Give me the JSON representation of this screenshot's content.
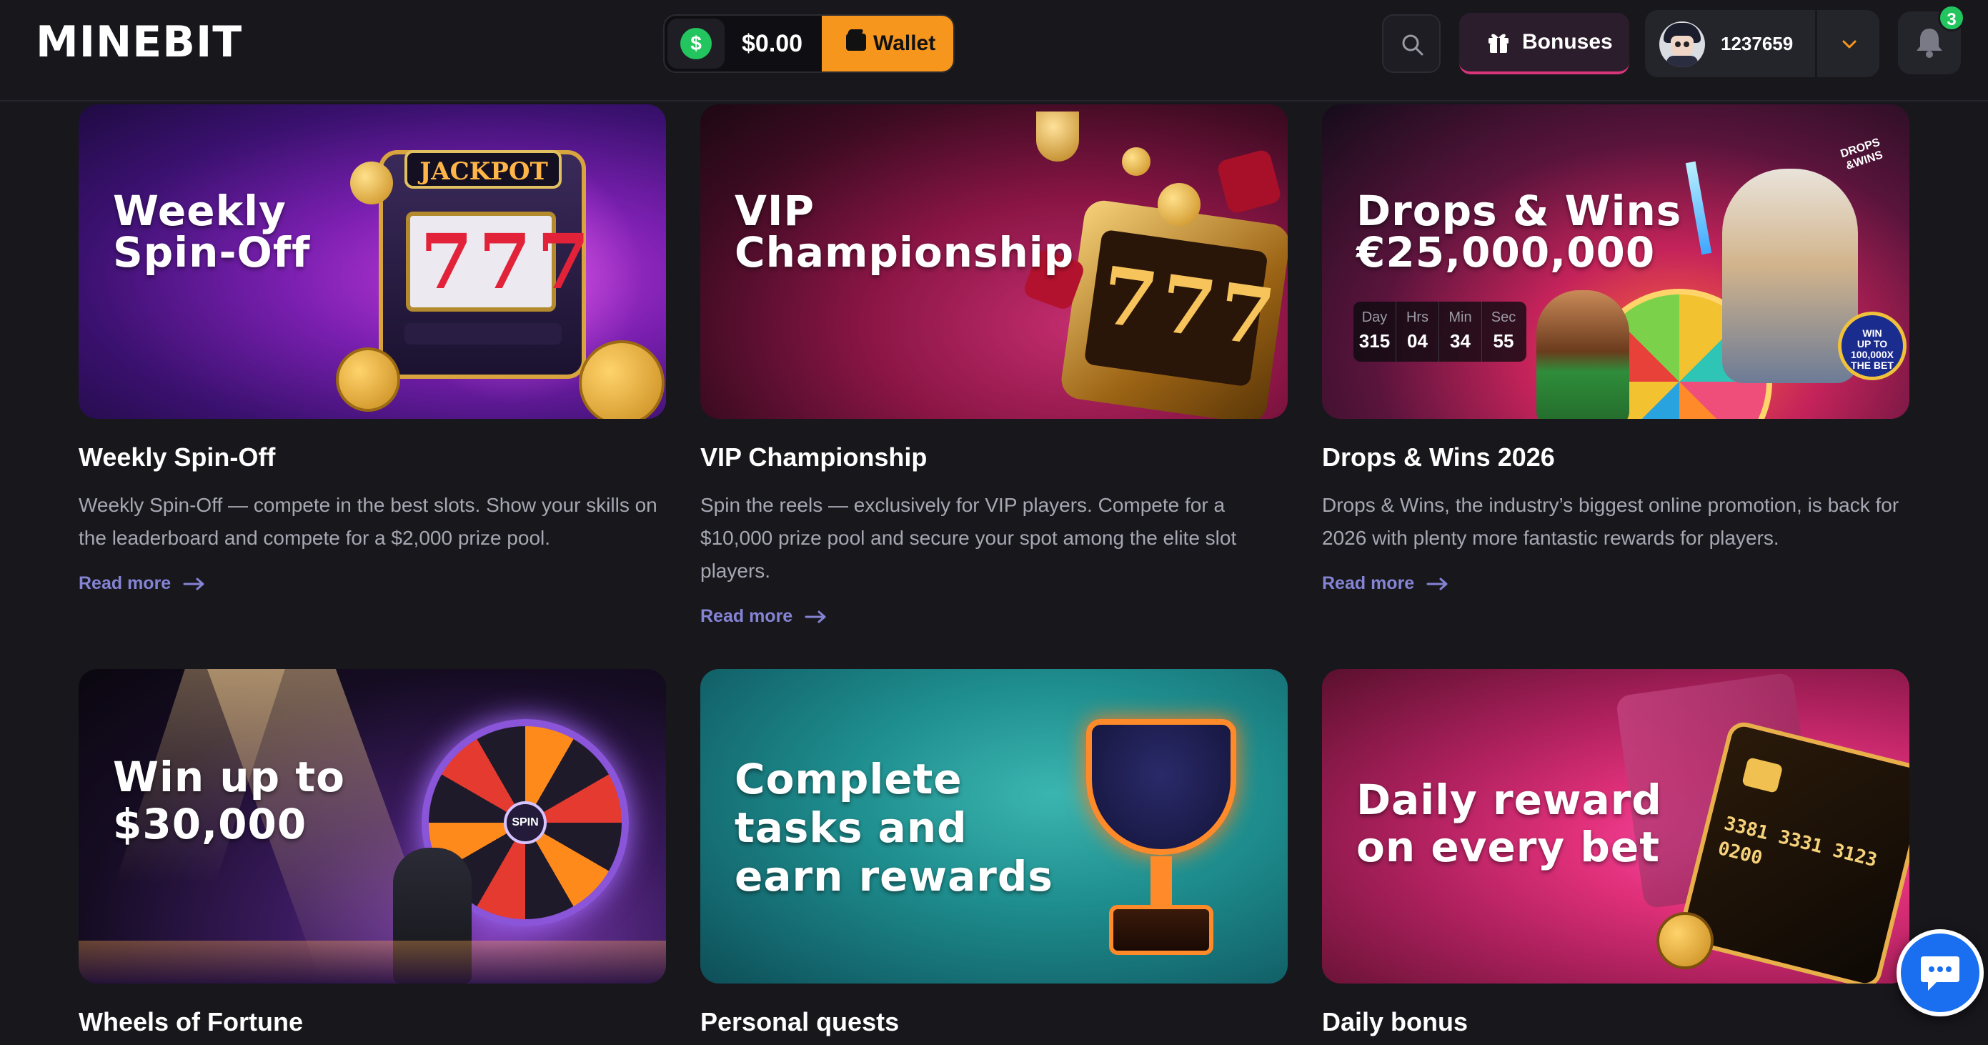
{
  "header": {
    "logo": "MINEBIT",
    "balance": "$0.00",
    "coin_symbol": "$",
    "wallet_label": "Wallet",
    "bonuses_label": "Bonuses",
    "user_id": "1237659",
    "notification_count": "3"
  },
  "colors": {
    "background": "#17171c",
    "wallet_accent": "#f7961c",
    "coin_green": "#22c55e",
    "bonus_underline": "#d9357a",
    "read_more": "#8583d4",
    "chat_blue": "#1a6ff0"
  },
  "icons": {
    "search": "search-icon",
    "gift": "gift-icon",
    "wallet": "wallet-icon",
    "chevron": "chevron-down-icon",
    "bell": "bell-icon",
    "arrow": "arrow-right-icon",
    "chat": "chat-icon"
  },
  "cards": [
    {
      "banner_title": "Weekly\nSpin-Off",
      "banner_text": "JACKPOT",
      "title": "Weekly Spin-Off",
      "description": "Weekly Spin-Off — compete in the best slots. Show your skills on the leaderboard and compete for a $2,000 prize pool.",
      "link": "Read more"
    },
    {
      "banner_title": "VIP\nChampionship",
      "title": "VIP Championship",
      "description": "Spin the reels — exclusively for VIP players. Compete for a $10,000 prize pool and secure your spot among the elite slot players.",
      "link": "Read more"
    },
    {
      "banner_title": "Drops & Wins\n€25,000,000",
      "banner_badge": "DROPS\n&WINS",
      "banner_win_badge": "WIN\nUP TO\n100,000X\nTHE BET",
      "countdown": [
        {
          "label": "Day",
          "value": "315"
        },
        {
          "label": "Hrs",
          "value": "04"
        },
        {
          "label": "Min",
          "value": "34"
        },
        {
          "label": "Sec",
          "value": "55"
        }
      ],
      "title": "Drops & Wins 2026",
      "description": "Drops & Wins, the industry’s biggest online promotion, is back for 2026 with plenty more fantastic rewards for players.",
      "link": "Read more"
    },
    {
      "banner_title": "Win up to\n$30,000",
      "wheel_center": "SPIN",
      "title": "Wheels of Fortune"
    },
    {
      "banner_title": "Complete\ntasks and\nearn rewards",
      "title": "Personal quests"
    },
    {
      "banner_title": "Daily reward\non every bet",
      "card_number": "3381 3331 3123 0200",
      "title": "Daily bonus"
    }
  ]
}
